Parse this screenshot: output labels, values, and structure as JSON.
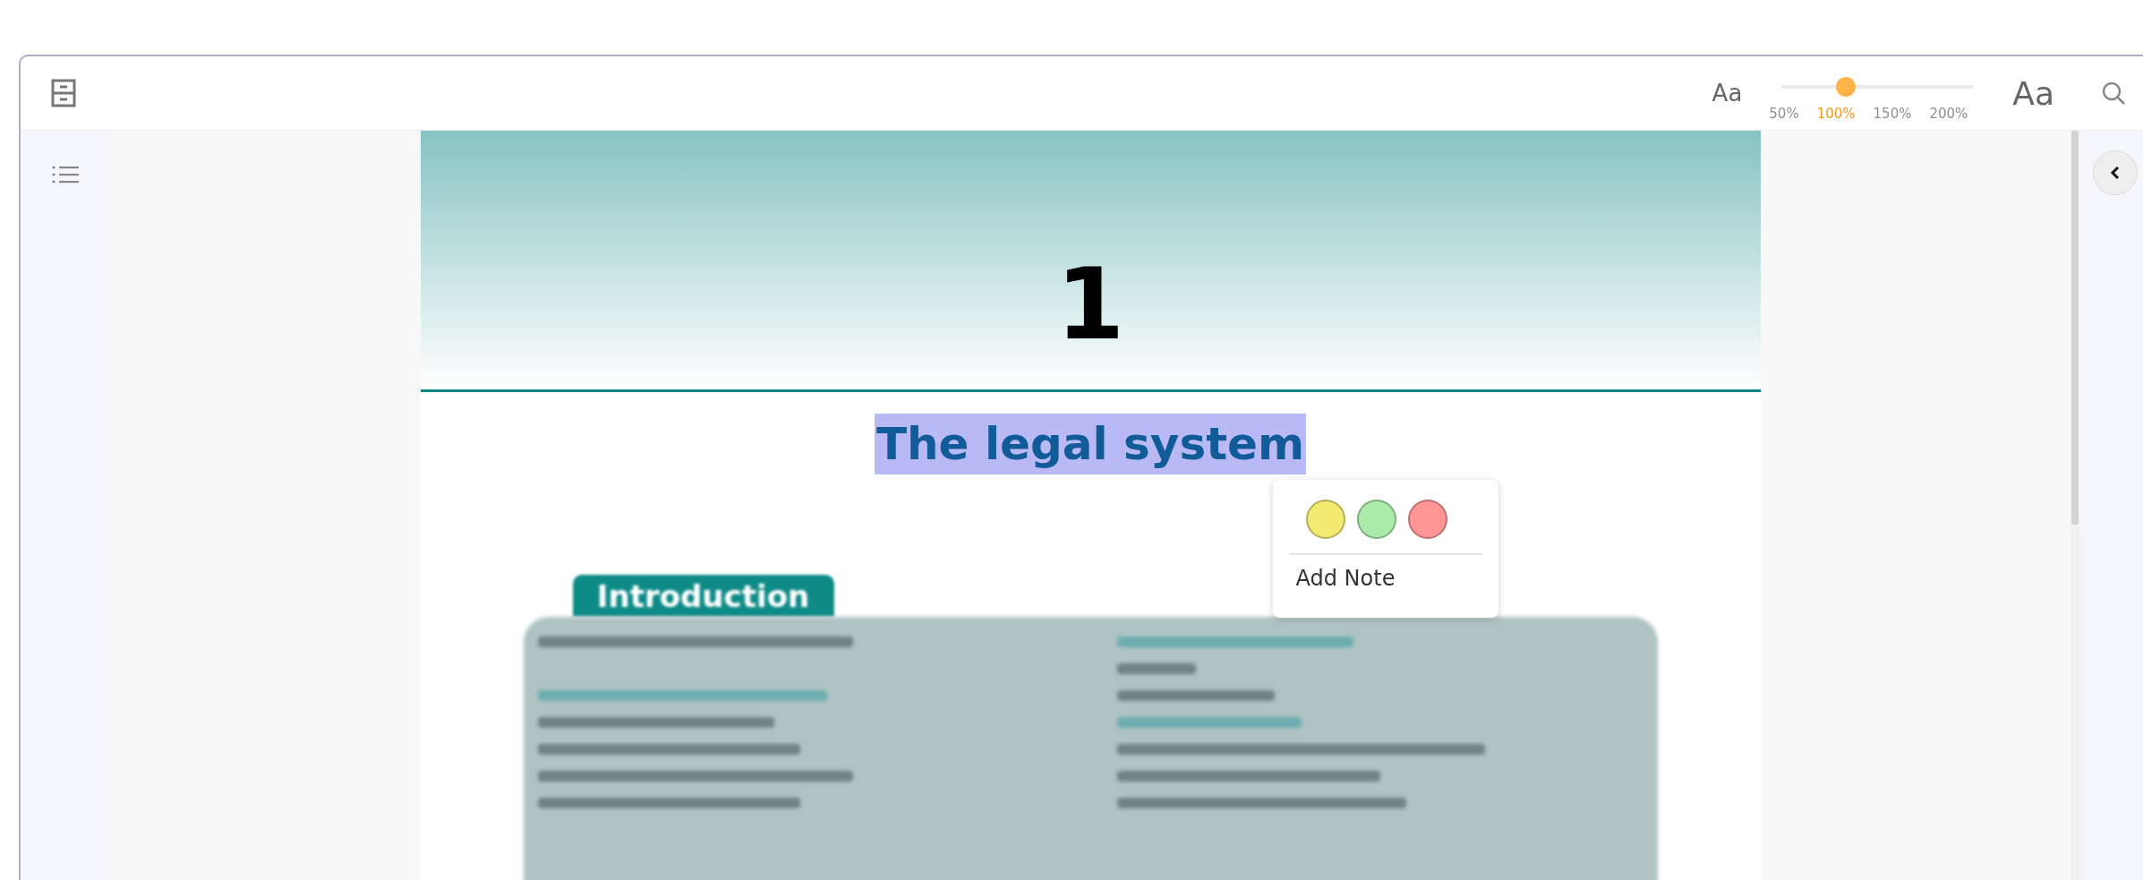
{
  "toolbar": {
    "font_size_small": "Aa",
    "font_size_large": "Aa",
    "zoom_slider": {
      "level": 0.333
    },
    "zoom_options": [
      {
        "label": "50%",
        "selected": false
      },
      {
        "label": "100%",
        "selected": true
      },
      {
        "label": "150%",
        "selected": false
      },
      {
        "label": "200%",
        "selected": false
      }
    ]
  },
  "page": {
    "chapter_number": "1",
    "chapter_title": "The legal system",
    "section_tab": "Introduction"
  },
  "highlight_popover": {
    "swatches": [
      {
        "color": "#f3ea72"
      },
      {
        "color": "#abeaa8"
      },
      {
        "color": "#ff9696"
      }
    ],
    "action": "Add Note"
  }
}
